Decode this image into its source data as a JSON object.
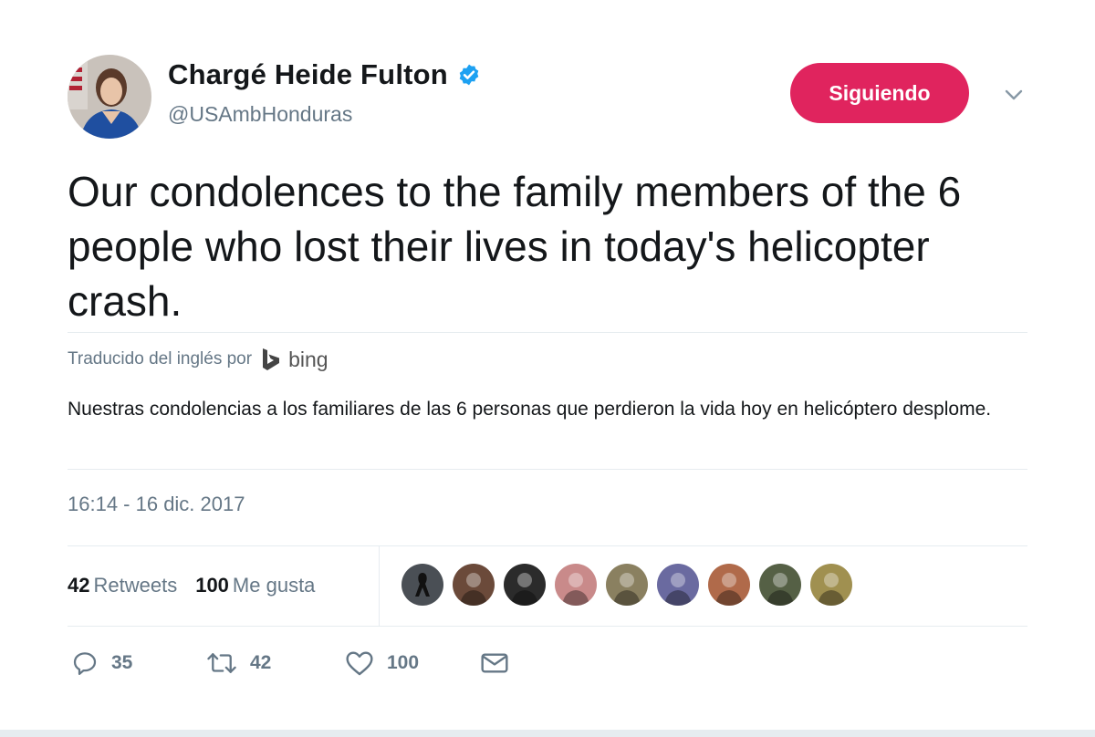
{
  "author": {
    "display_name": "Chargé Heide Fulton",
    "handle": "@USAmbHonduras",
    "verified": true,
    "verified_color": "#1da1f2"
  },
  "follow_button": {
    "label": "Siguiendo",
    "color": "#e0245e"
  },
  "tweet": {
    "text": "Our condolences to the family members of the 6 people who lost their lives in today's helicopter crash."
  },
  "translation": {
    "label": "Traducido del inglés por",
    "provider": "bing",
    "text": "Nuestras condolencias a los familiares de las 6 personas que perdieron la vida hoy en helicóptero desplome."
  },
  "timestamp": "16:14 - 16 dic. 2017",
  "stats": {
    "retweets_count": "42",
    "retweets_label": "Retweets",
    "likes_count": "100",
    "likes_label": "Me gusta"
  },
  "likers": [
    {
      "name": "liker-avatar-1",
      "color": "#4a4f55"
    },
    {
      "name": "liker-avatar-2",
      "color": "#6b4a3a"
    },
    {
      "name": "liker-avatar-3",
      "color": "#2b2b2b"
    },
    {
      "name": "liker-avatar-4",
      "color": "#c98a8a"
    },
    {
      "name": "liker-avatar-5",
      "color": "#8a8060"
    },
    {
      "name": "liker-avatar-6",
      "color": "#6a6aa0"
    },
    {
      "name": "liker-avatar-7",
      "color": "#b06a4a"
    },
    {
      "name": "liker-avatar-8",
      "color": "#556045"
    },
    {
      "name": "liker-avatar-9",
      "color": "#a09050"
    }
  ],
  "actions": {
    "replies": "35",
    "retweets": "42",
    "likes": "100"
  },
  "icons": {
    "reply": "reply-icon",
    "retweet": "retweet-icon",
    "like": "heart-icon",
    "dm": "envelope-icon",
    "caret": "chevron-down-icon",
    "verified": "verified-badge-icon"
  }
}
